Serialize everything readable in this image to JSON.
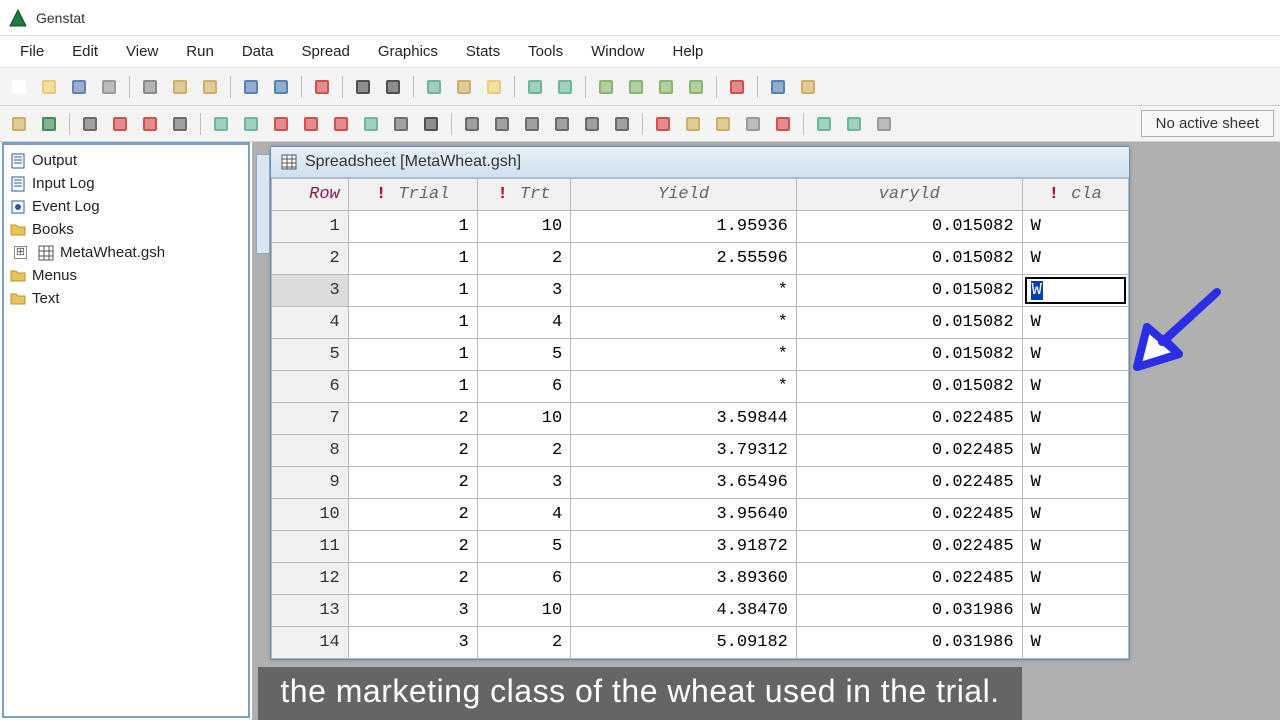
{
  "app": {
    "title": "Genstat"
  },
  "menu": [
    "File",
    "Edit",
    "View",
    "Run",
    "Data",
    "Spread",
    "Graphics",
    "Stats",
    "Tools",
    "Window",
    "Help"
  ],
  "status": {
    "sheet_label": "No active sheet"
  },
  "nav": {
    "items": [
      {
        "label": "Output",
        "icon": "doc"
      },
      {
        "label": "Input Log",
        "icon": "doc"
      },
      {
        "label": "Event Log",
        "icon": "event"
      },
      {
        "label": "Books",
        "icon": "folder"
      },
      {
        "label": "MetaWheat.gsh",
        "icon": "grid",
        "indent": true
      },
      {
        "label": "Menus",
        "icon": "folder"
      },
      {
        "label": "Text",
        "icon": "folder"
      }
    ]
  },
  "sheet": {
    "title": "Spreadsheet [MetaWheat.gsh]",
    "row_header": "Row",
    "columns": [
      {
        "label": "Trial",
        "flag": true,
        "cls": "col-trial"
      },
      {
        "label": "Trt",
        "flag": true,
        "cls": "col-trt"
      },
      {
        "label": "Yield",
        "flag": false,
        "cls": "col-yield"
      },
      {
        "label": "varyld",
        "flag": false,
        "cls": "col-varyld"
      },
      {
        "label": "cla",
        "flag": true,
        "cls": "col-cla"
      }
    ],
    "editing_row": 3,
    "editing_value": "W",
    "rows": [
      {
        "n": 1,
        "c": [
          "1",
          "10",
          "1.95936",
          "0.015082",
          "W"
        ]
      },
      {
        "n": 2,
        "c": [
          "1",
          "2",
          "2.55596",
          "0.015082",
          "W"
        ]
      },
      {
        "n": 3,
        "c": [
          "1",
          "3",
          "*",
          "0.015082",
          "W"
        ]
      },
      {
        "n": 4,
        "c": [
          "1",
          "4",
          "*",
          "0.015082",
          "W"
        ]
      },
      {
        "n": 5,
        "c": [
          "1",
          "5",
          "*",
          "0.015082",
          "W"
        ]
      },
      {
        "n": 6,
        "c": [
          "1",
          "6",
          "*",
          "0.015082",
          "W"
        ]
      },
      {
        "n": 7,
        "c": [
          "2",
          "10",
          "3.59844",
          "0.022485",
          "W"
        ]
      },
      {
        "n": 8,
        "c": [
          "2",
          "2",
          "3.79312",
          "0.022485",
          "W"
        ]
      },
      {
        "n": 9,
        "c": [
          "2",
          "3",
          "3.65496",
          "0.022485",
          "W"
        ]
      },
      {
        "n": 10,
        "c": [
          "2",
          "4",
          "3.95640",
          "0.022485",
          "W"
        ]
      },
      {
        "n": 11,
        "c": [
          "2",
          "5",
          "3.91872",
          "0.022485",
          "W"
        ]
      },
      {
        "n": 12,
        "c": [
          "2",
          "6",
          "3.89360",
          "0.022485",
          "W"
        ]
      },
      {
        "n": 13,
        "c": [
          "3",
          "10",
          "4.38470",
          "0.031986",
          "W"
        ]
      },
      {
        "n": 14,
        "c": [
          "3",
          "2",
          "5.09182",
          "0.031986",
          "W"
        ]
      }
    ]
  },
  "caption": "the marketing class of the wheat used in the trial.",
  "icons": {
    "toolbar1": [
      "new",
      "open",
      "save",
      "print",
      "|",
      "cut",
      "copy",
      "paste",
      "|",
      "undo",
      "redo",
      "|",
      "clear",
      "|",
      "find",
      "replace",
      "|",
      "table",
      "calc",
      "folder-open",
      "|",
      "list-dn",
      "list-up",
      "|",
      "db1",
      "db2",
      "db3",
      "db4",
      "|",
      "chart",
      "|",
      "help",
      "grid-view"
    ],
    "toolbar2": [
      "sheet-new",
      "excel",
      "|",
      "fork",
      "del-col",
      "del-mark",
      "cols",
      "|",
      "ins-left",
      "ins-edit",
      "sort-a",
      "sort-d",
      "sort-x",
      "sort-cols",
      "sort-az",
      "sigma",
      "|",
      "width",
      "align-l",
      "align-c",
      "align-r",
      "dec-inc",
      "dec-dec",
      "|",
      "hl1",
      "hl2",
      "hl3",
      "hl4",
      "hl5",
      "|",
      "copy2",
      "copy3",
      "props"
    ]
  }
}
